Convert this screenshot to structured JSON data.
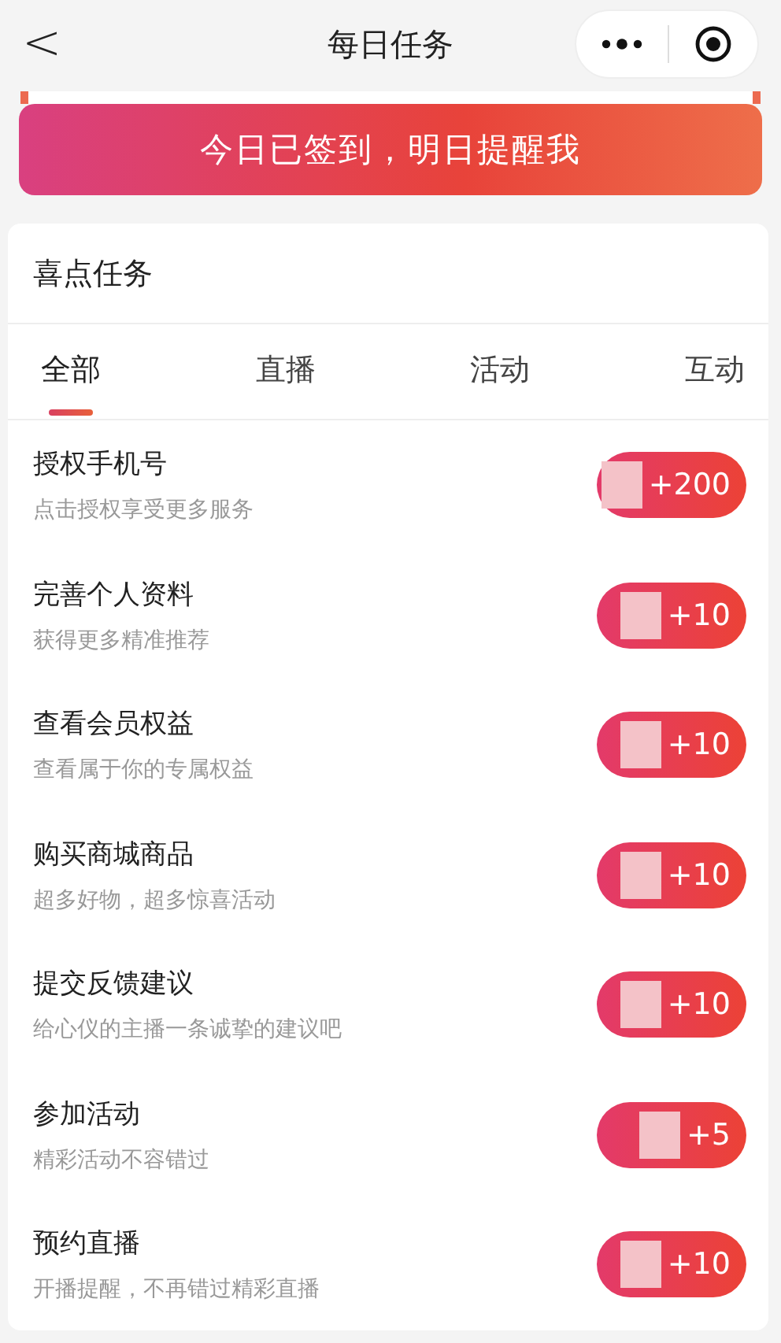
{
  "nav": {
    "back": "<",
    "title": "每日任务"
  },
  "banner": {
    "label": "今日已签到，明日提醒我"
  },
  "section": {
    "title": "喜点任务"
  },
  "tabs": [
    {
      "label": "全部",
      "selected": true
    },
    {
      "label": "直播",
      "selected": false
    },
    {
      "label": "活动",
      "selected": false
    },
    {
      "label": "互动",
      "selected": false
    }
  ],
  "tasks": [
    {
      "title": "授权手机号",
      "subtitle": "点击授权享受更多服务",
      "points": "+200"
    },
    {
      "title": "完善个人资料",
      "subtitle": "获得更多精准推荐",
      "points": "+10"
    },
    {
      "title": "查看会员权益",
      "subtitle": "查看属于你的专属权益",
      "points": "+10"
    },
    {
      "title": "购买商城商品",
      "subtitle": "超多好物，超多惊喜活动",
      "points": "+10"
    },
    {
      "title": "提交反馈建议",
      "subtitle": "给心仪的主播一条诚挚的建议吧",
      "points": "+10"
    },
    {
      "title": "参加活动",
      "subtitle": "精彩活动不容错过",
      "points": "+5"
    },
    {
      "title": "预约直播",
      "subtitle": "开播提醒，不再错过精彩直播",
      "points": "+10"
    }
  ]
}
